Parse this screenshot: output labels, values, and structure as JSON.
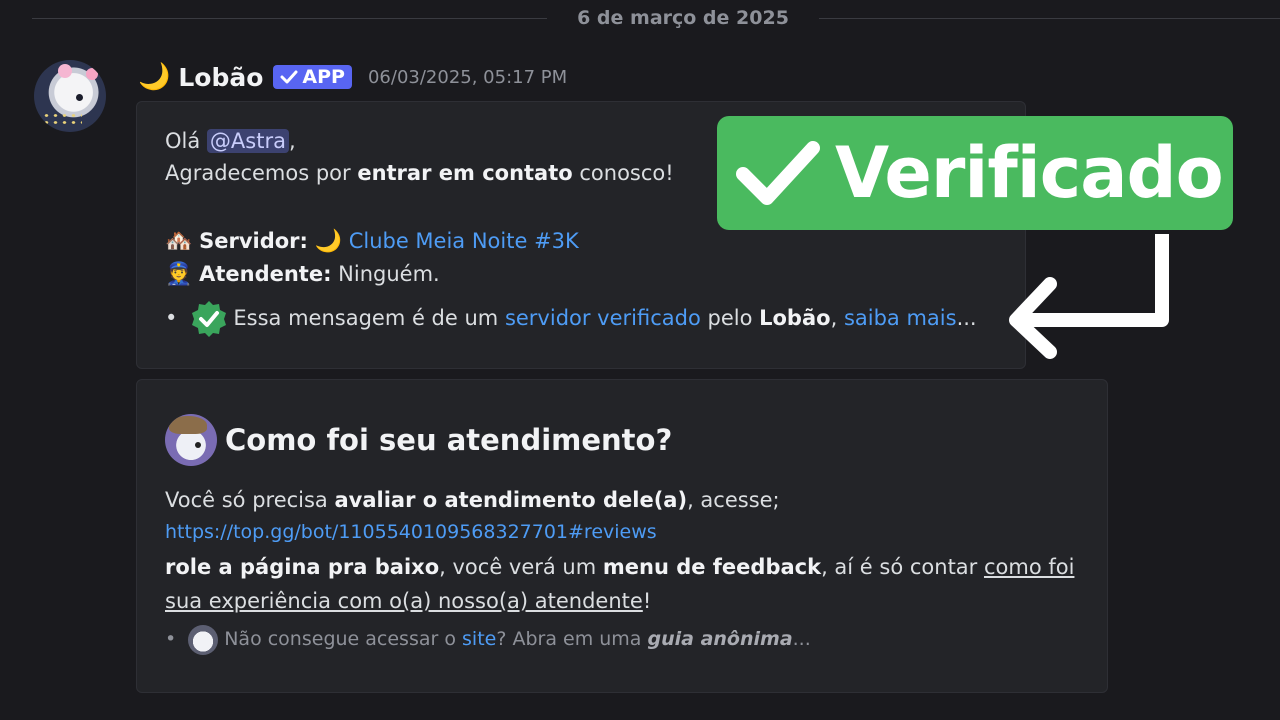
{
  "date_divider": "6 de março de 2025",
  "message": {
    "author_emoji": "🌙",
    "author": "Lobão",
    "app_badge": "APP",
    "timestamp": "06/03/2025, 05:17 PM"
  },
  "embed1": {
    "greeting": "Olá",
    "mention": "@Astra",
    "comma": ",",
    "line2_pre": "Agradecemos por ",
    "line2_bold": "entrar em contato",
    "line2_post": " conosco!",
    "server_emoji": "🏘️",
    "server_label": "Servidor:",
    "server_moon": "🌙",
    "server_value": "Clube Meia Noite #3K",
    "attendant_emoji": "👮",
    "attendant_label": "Atendente:",
    "attendant_value": "Ninguém.",
    "bullet": "•",
    "note_pre": "Essa mensagem é de um ",
    "note_link": "servidor verificado",
    "note_mid": " pelo ",
    "note_bold": "Lobão",
    "note_comma": ",",
    "note_link2": "saiba mais",
    "note_end": "..."
  },
  "embed2": {
    "title": "Como foi seu atendimento?",
    "line1_pre": "Você só precisa ",
    "line1_bold": "avaliar o atendimento dele(a)",
    "line1_post": ", acesse;",
    "url": "https://top.gg/bot/1105540109568327701#reviews",
    "line3_bold1": "role a página pra baixo",
    "line3_mid": ", você verá um ",
    "line3_bold2": "menu de feedback",
    "line3_post": ", aí é só contar ",
    "line3_u": "como foi",
    "line4_u": "sua experiência com o(a) nosso(a) atendente",
    "line4_end": "!",
    "footer_bullet": "•",
    "footer_pre": "Não consegue acessar o ",
    "footer_link": "site",
    "footer_mid": "? Abra em uma ",
    "footer_bold": "guia anônima",
    "footer_end": "..."
  },
  "overlay": {
    "verified_label": "Verificado"
  },
  "colors": {
    "accent_green": "#4aba5f",
    "blurple": "#5865f2",
    "link": "#4e9cf5"
  }
}
